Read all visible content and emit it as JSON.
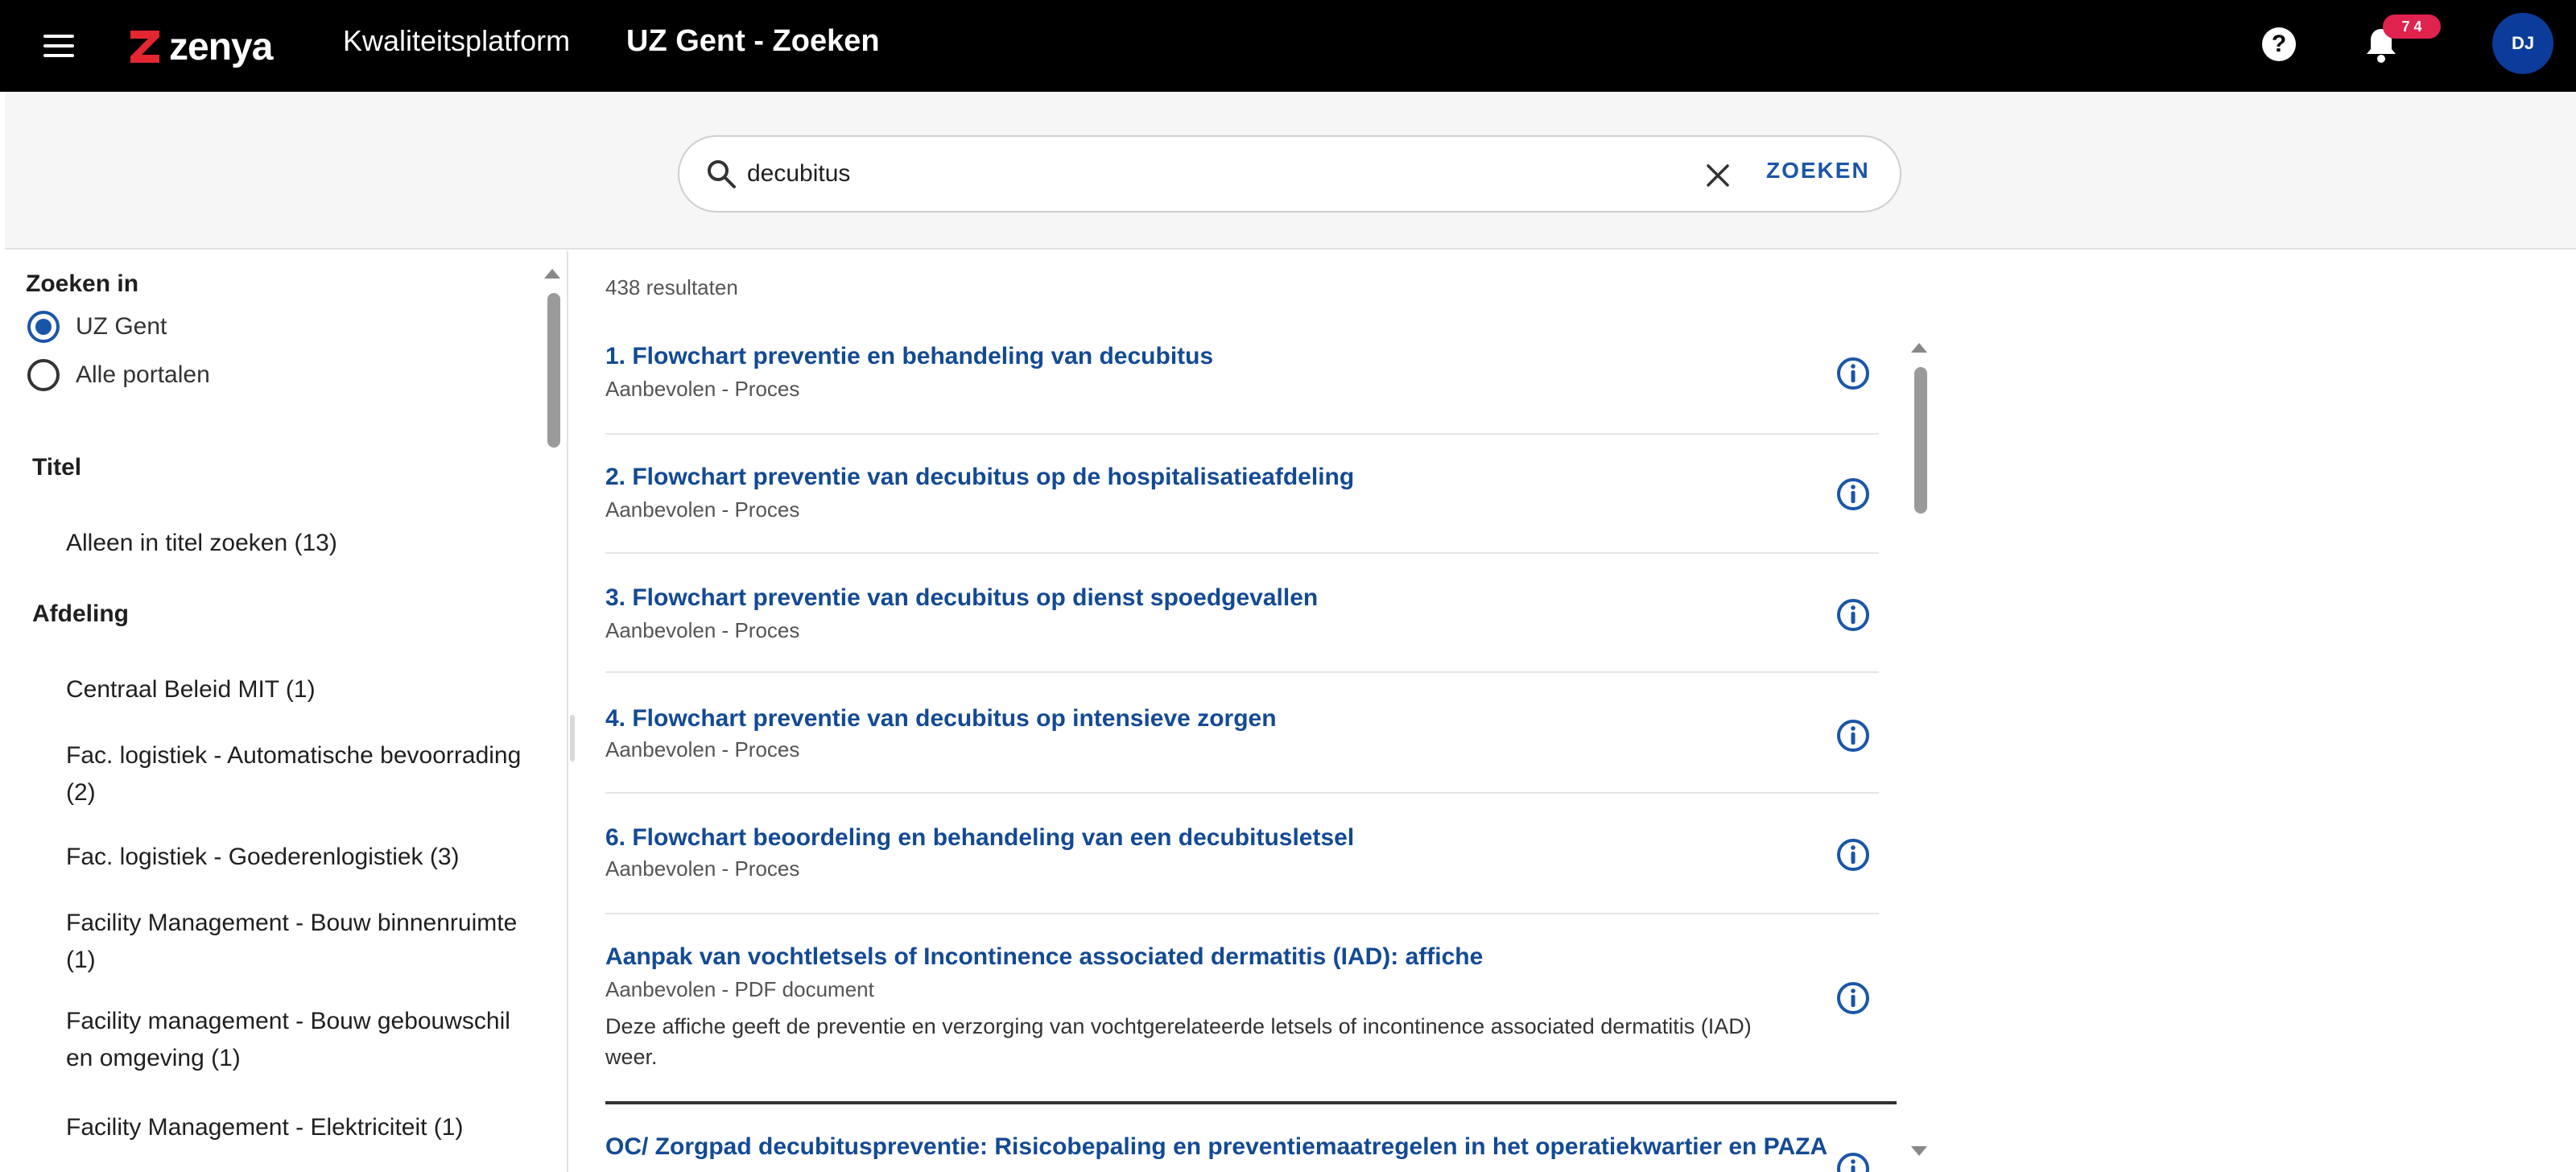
{
  "header": {
    "logo_text": "zenya",
    "app_title": "Kwaliteitsplatform",
    "page_title": "UZ Gent - Zoeken",
    "help_label": "?",
    "notification_badge": "7 4",
    "avatar_initials": "DJ"
  },
  "search": {
    "query": "decubitus",
    "button_label": "ZOEKEN"
  },
  "sidebar": {
    "zoeken_in": {
      "heading": "Zoeken in",
      "options": [
        {
          "label": "UZ Gent",
          "checked": true
        },
        {
          "label": "Alle portalen",
          "checked": false
        }
      ]
    },
    "titel": {
      "heading": "Titel",
      "items": [
        "Alleen in titel zoeken (13)"
      ]
    },
    "afdeling": {
      "heading": "Afdeling",
      "items": [
        "Centraal Beleid MIT (1)",
        "Fac. logistiek - Automatische bevoorrading (2)",
        "Fac. logistiek - Goederenlogistiek (3)",
        "Facility Management - Bouw binnenruimte (1)",
        "Facility management - Bouw gebouwschil en omgeving (1)",
        "Facility Management - Elektriciteit (1)"
      ]
    }
  },
  "results": {
    "count_label": "438 resultaten",
    "items": [
      {
        "title": "1. Flowchart preventie en behandeling van decubitus",
        "meta": "Aanbevolen - Proces"
      },
      {
        "title": "2. Flowchart preventie van decubitus op de hospitalisatieafdeling",
        "meta": "Aanbevolen - Proces"
      },
      {
        "title": "3. Flowchart preventie van decubitus op dienst spoedgevallen",
        "meta": "Aanbevolen - Proces"
      },
      {
        "title": "4. Flowchart preventie van decubitus op intensieve zorgen",
        "meta": "Aanbevolen - Proces"
      },
      {
        "title": "6. Flowchart beoordeling en behandeling van een decubitusletsel",
        "meta": "Aanbevolen - Proces"
      },
      {
        "title": "Aanpak van vochtletsels of Incontinence associated dermatitis (IAD): affiche",
        "meta": "Aanbevolen - PDF document",
        "description": "Deze affiche geeft de preventie en verzorging van vochtgerelateerde letsels of incontinence associated dermatitis (IAD) weer."
      },
      {
        "title": "OC/ Zorgpad decubituspreventie: Risicobepaling en preventiemaatregelen in het operatiekwartier en PAZA"
      }
    ]
  },
  "colors": {
    "topbar": "#000000",
    "accent_blue": "#134a94",
    "badge_red": "#e0224e",
    "avatar_blue": "#0b3c9c",
    "logo_red": "#e3262f"
  },
  "icons": {
    "menu": "hamburger-icon",
    "search": "search-icon",
    "clear": "close-icon",
    "help": "help-icon",
    "notifications": "bell-icon",
    "info": "info-icon"
  }
}
